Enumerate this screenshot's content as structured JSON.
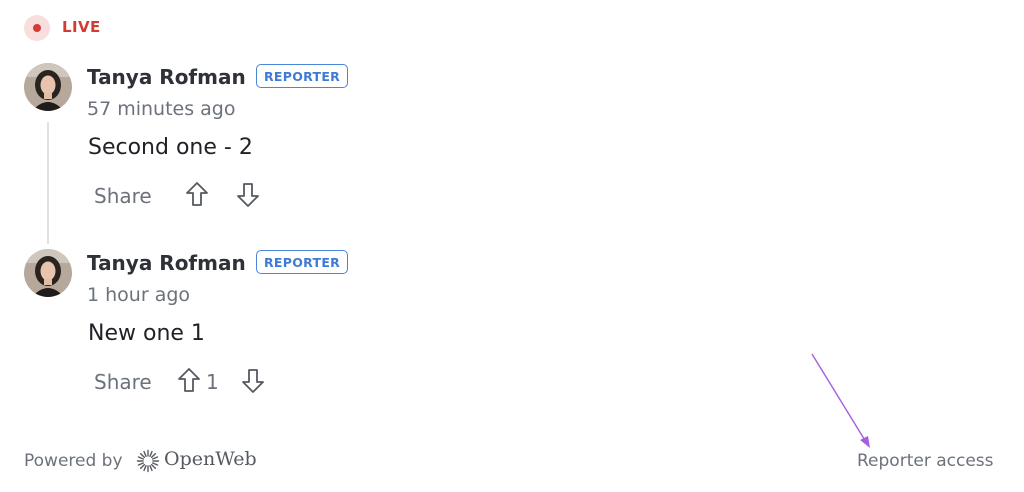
{
  "live": {
    "label": "LIVE",
    "color": "#d53b35"
  },
  "comments": [
    {
      "author": "Tanya Rofman",
      "badge": "REPORTER",
      "time": "57 minutes ago",
      "text": "Second one - 2",
      "share_label": "Share",
      "upvotes": ""
    },
    {
      "author": "Tanya Rofman",
      "badge": "REPORTER",
      "time": "1 hour ago",
      "text": "New one 1",
      "share_label": "Share",
      "upvotes": "1"
    }
  ],
  "footer": {
    "powered_by": "Powered by",
    "brand": "OpenWeb",
    "reporter_access": "Reporter access"
  },
  "icons": [
    "live-dot-icon",
    "upvote-arrow-icon",
    "downvote-arrow-icon",
    "openweb-logo-icon",
    "annotation-arrow-icon"
  ],
  "colors": {
    "badge": "#3d7bd6",
    "annotation_arrow": "#a45fe0"
  }
}
